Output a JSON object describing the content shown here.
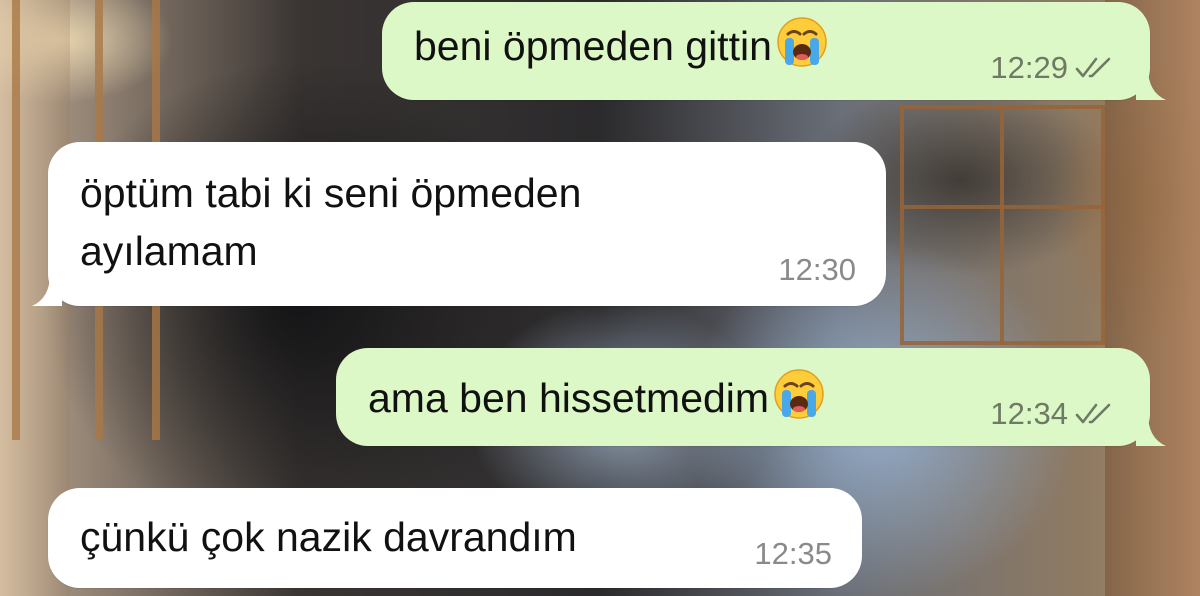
{
  "messages": [
    {
      "direction": "outgoing",
      "text": "beni öpmeden gittin",
      "emoji": "loudly-crying-face",
      "time": "12:29",
      "status": "read"
    },
    {
      "direction": "incoming",
      "text_line1": "öptüm tabi ki seni öpmeden",
      "text_line2": "ayılamam",
      "time": "12:30"
    },
    {
      "direction": "outgoing",
      "text": "ama ben hissetmedim",
      "emoji": "loudly-crying-face",
      "time": "12:34",
      "status": "read"
    },
    {
      "direction": "incoming",
      "text": "çünkü çok nazik davrandım",
      "time": "12:35"
    }
  ],
  "colors": {
    "outgoing_bubble": "#dcf8c6",
    "incoming_bubble": "#ffffff",
    "timestamp_out": "#6f7a66",
    "timestamp_in": "#8a8a8a"
  }
}
